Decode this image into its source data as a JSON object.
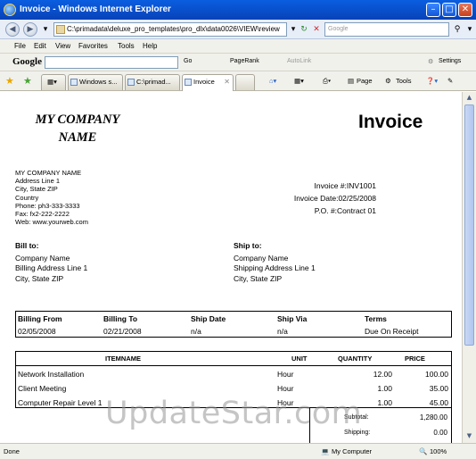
{
  "window": {
    "title": "Invoice - Windows Internet Explorer"
  },
  "address_bar": {
    "url": "C:\\primadata\\deluxe_pro_templates\\pro_dlx\\data0026\\VIEW\\review",
    "search_placeholder": "Google"
  },
  "menu": [
    "File",
    "Edit",
    "View",
    "Favorites",
    "Tools",
    "Help"
  ],
  "google_toolbar": {
    "logo": "Google",
    "items": [
      "Go",
      "PageRank",
      "AutoLink",
      "Settings"
    ]
  },
  "tabs": [
    {
      "label": "Windows s..."
    },
    {
      "label": "C:\\primad..."
    },
    {
      "label": "Invoice"
    }
  ],
  "command_bar": [
    "Page",
    "Tools"
  ],
  "invoice": {
    "company_logo_line1": "MY COMPANY",
    "company_logo_line2": "NAME",
    "title": "Invoice",
    "address": [
      "MY COMPANY NAME",
      "Address Line 1",
      "City, State ZIP",
      "Country",
      "Phone: ph3-333-3333",
      "Fax: fx2-222-2222",
      "Web: www.yourweb.com"
    ],
    "meta": {
      "invoice_no": "Invoice #:INV1001",
      "invoice_date": "Invoice Date:02/25/2008",
      "po": "P.O. #:Contract 01"
    },
    "bill_to": {
      "heading": "Bill to:",
      "lines": [
        "Company Name",
        "Billing Address Line 1",
        "City, State ZIP"
      ]
    },
    "ship_to": {
      "heading": "Ship to:",
      "lines": [
        "Company Name",
        "Shipping Address Line 1",
        "City, State ZIP"
      ]
    },
    "billing": {
      "headers": [
        "Billing From",
        "Billing To",
        "Ship Date",
        "Ship Via",
        "Terms"
      ],
      "values": [
        "02/05/2008",
        "02/21/2008",
        "n/a",
        "n/a",
        "Due On Receipt"
      ]
    },
    "items": {
      "headers": [
        "ITEMNAME",
        "UNIT",
        "QUANTITY",
        "PRICE"
      ],
      "rows": [
        {
          "name": "Network Installation",
          "unit": "Hour",
          "qty": "12.00",
          "price": "100.00"
        },
        {
          "name": "Client Meeting",
          "unit": "Hour",
          "qty": "1.00",
          "price": "35.00"
        },
        {
          "name": "Computer Repair Level 1",
          "unit": "Hour",
          "qty": "1.00",
          "price": "45.00"
        }
      ]
    },
    "totals": {
      "subtotal_label": "Subtotal:",
      "subtotal": "1,280.00",
      "shipping_label": "Shipping:",
      "shipping": "0.00"
    }
  },
  "watermark": "UpdateStar.com",
  "status": {
    "left": "Done",
    "zone": "My Computer",
    "zoom": "100%"
  }
}
